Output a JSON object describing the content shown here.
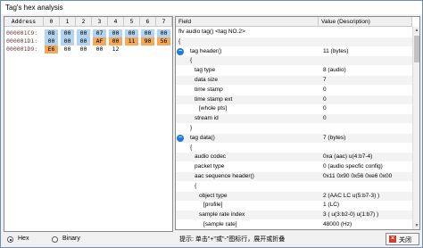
{
  "window": {
    "title": "Tag's hex analysis"
  },
  "hex": {
    "header": [
      "Address",
      "0",
      "1",
      "2",
      "3",
      "4",
      "5",
      "6",
      "7"
    ],
    "rows": [
      {
        "address": "000001C9:",
        "bytes": [
          "08",
          "00",
          "00",
          "07",
          "00",
          "00",
          "00",
          "00"
        ]
      },
      {
        "address": "000001D1:",
        "bytes": [
          "00",
          "00",
          "00",
          "AF",
          "00",
          "11",
          "90",
          "56"
        ]
      },
      {
        "address": "000001D9:",
        "bytes": [
          "E6",
          "00",
          "00",
          "00",
          "12",
          "",
          "",
          ""
        ]
      }
    ],
    "highlight_colors": {
      "blue": "#b3d4f0",
      "orange": "#f3a85c"
    }
  },
  "view_mode": {
    "hex_label": "Hex",
    "binary_label": "Binary",
    "selected": "Hex"
  },
  "tree": {
    "columns": [
      "Field",
      "Value (Description)"
    ],
    "rows": [
      {
        "field": "flv audio tag()   <tag NO.2>",
        "value": "",
        "indent": 0
      },
      {
        "field": "{",
        "value": "",
        "indent": 0
      },
      {
        "field": "tag header()",
        "value": "11 (bytes)",
        "indent": 1,
        "collapse": true
      },
      {
        "field": "{",
        "value": "",
        "indent": 1
      },
      {
        "field": "tag type",
        "value": "8 (audio)",
        "indent": 2
      },
      {
        "field": "data size",
        "value": "7",
        "indent": 2
      },
      {
        "field": "time stamp",
        "value": "0",
        "indent": 2
      },
      {
        "field": "time stamp ext",
        "value": "0",
        "indent": 2
      },
      {
        "field": "[whole pts]",
        "value": "0",
        "indent": 3
      },
      {
        "field": "stream id",
        "value": "0",
        "indent": 2
      },
      {
        "field": "}",
        "value": "",
        "indent": 1
      },
      {
        "field": "tag data()",
        "value": "7 (bytes)",
        "indent": 1,
        "collapse": true
      },
      {
        "field": "{",
        "value": "",
        "indent": 1
      },
      {
        "field": "audio codec",
        "value": "0xa (aac)  u(4:b7-4)",
        "indent": 2
      },
      {
        "field": "packet type",
        "value": "0 (audio specfic config)",
        "indent": 2
      },
      {
        "field": "aac sequence header()",
        "value": "0x11 0x90 0x56 0xe6 0x00",
        "indent": 2
      },
      {
        "field": "{",
        "value": "",
        "indent": 2
      },
      {
        "field": "object type",
        "value": "2 (AAC LC  u(5:b7-3) )",
        "indent": 3
      },
      {
        "field": "[profile]",
        "value": "1 (LC)",
        "indent": 4
      },
      {
        "field": "sample rate index",
        "value": "3 ( u(3:b2-0) u(1:b7) )",
        "indent": 3
      },
      {
        "field": "[sample rate]",
        "value": "48000 (Hz)",
        "indent": 4
      }
    ]
  },
  "status": {
    "hint": "提示: 单击\"+\"或\"-\"图标行，展开或折叠"
  },
  "buttons": {
    "close_label": "关闭",
    "close_icon_glyph": "×"
  }
}
